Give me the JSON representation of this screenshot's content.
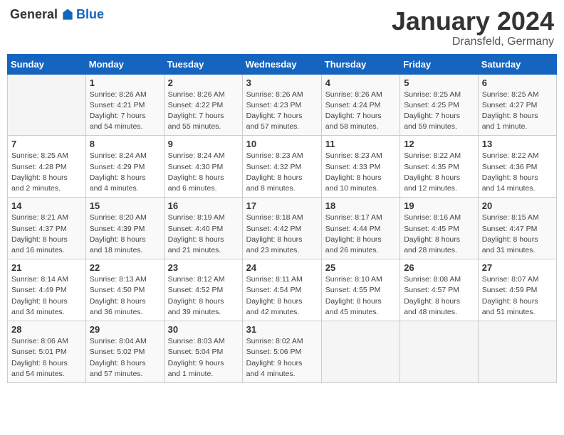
{
  "header": {
    "logo_general": "General",
    "logo_blue": "Blue",
    "month": "January 2024",
    "location": "Dransfeld, Germany"
  },
  "weekdays": [
    "Sunday",
    "Monday",
    "Tuesday",
    "Wednesday",
    "Thursday",
    "Friday",
    "Saturday"
  ],
  "weeks": [
    [
      {
        "day": "",
        "info": ""
      },
      {
        "day": "1",
        "info": "Sunrise: 8:26 AM\nSunset: 4:21 PM\nDaylight: 7 hours\nand 54 minutes."
      },
      {
        "day": "2",
        "info": "Sunrise: 8:26 AM\nSunset: 4:22 PM\nDaylight: 7 hours\nand 55 minutes."
      },
      {
        "day": "3",
        "info": "Sunrise: 8:26 AM\nSunset: 4:23 PM\nDaylight: 7 hours\nand 57 minutes."
      },
      {
        "day": "4",
        "info": "Sunrise: 8:26 AM\nSunset: 4:24 PM\nDaylight: 7 hours\nand 58 minutes."
      },
      {
        "day": "5",
        "info": "Sunrise: 8:25 AM\nSunset: 4:25 PM\nDaylight: 7 hours\nand 59 minutes."
      },
      {
        "day": "6",
        "info": "Sunrise: 8:25 AM\nSunset: 4:27 PM\nDaylight: 8 hours\nand 1 minute."
      }
    ],
    [
      {
        "day": "7",
        "info": "Sunrise: 8:25 AM\nSunset: 4:28 PM\nDaylight: 8 hours\nand 2 minutes."
      },
      {
        "day": "8",
        "info": "Sunrise: 8:24 AM\nSunset: 4:29 PM\nDaylight: 8 hours\nand 4 minutes."
      },
      {
        "day": "9",
        "info": "Sunrise: 8:24 AM\nSunset: 4:30 PM\nDaylight: 8 hours\nand 6 minutes."
      },
      {
        "day": "10",
        "info": "Sunrise: 8:23 AM\nSunset: 4:32 PM\nDaylight: 8 hours\nand 8 minutes."
      },
      {
        "day": "11",
        "info": "Sunrise: 8:23 AM\nSunset: 4:33 PM\nDaylight: 8 hours\nand 10 minutes."
      },
      {
        "day": "12",
        "info": "Sunrise: 8:22 AM\nSunset: 4:35 PM\nDaylight: 8 hours\nand 12 minutes."
      },
      {
        "day": "13",
        "info": "Sunrise: 8:22 AM\nSunset: 4:36 PM\nDaylight: 8 hours\nand 14 minutes."
      }
    ],
    [
      {
        "day": "14",
        "info": "Sunrise: 8:21 AM\nSunset: 4:37 PM\nDaylight: 8 hours\nand 16 minutes."
      },
      {
        "day": "15",
        "info": "Sunrise: 8:20 AM\nSunset: 4:39 PM\nDaylight: 8 hours\nand 18 minutes."
      },
      {
        "day": "16",
        "info": "Sunrise: 8:19 AM\nSunset: 4:40 PM\nDaylight: 8 hours\nand 21 minutes."
      },
      {
        "day": "17",
        "info": "Sunrise: 8:18 AM\nSunset: 4:42 PM\nDaylight: 8 hours\nand 23 minutes."
      },
      {
        "day": "18",
        "info": "Sunrise: 8:17 AM\nSunset: 4:44 PM\nDaylight: 8 hours\nand 26 minutes."
      },
      {
        "day": "19",
        "info": "Sunrise: 8:16 AM\nSunset: 4:45 PM\nDaylight: 8 hours\nand 28 minutes."
      },
      {
        "day": "20",
        "info": "Sunrise: 8:15 AM\nSunset: 4:47 PM\nDaylight: 8 hours\nand 31 minutes."
      }
    ],
    [
      {
        "day": "21",
        "info": "Sunrise: 8:14 AM\nSunset: 4:49 PM\nDaylight: 8 hours\nand 34 minutes."
      },
      {
        "day": "22",
        "info": "Sunrise: 8:13 AM\nSunset: 4:50 PM\nDaylight: 8 hours\nand 36 minutes."
      },
      {
        "day": "23",
        "info": "Sunrise: 8:12 AM\nSunset: 4:52 PM\nDaylight: 8 hours\nand 39 minutes."
      },
      {
        "day": "24",
        "info": "Sunrise: 8:11 AM\nSunset: 4:54 PM\nDaylight: 8 hours\nand 42 minutes."
      },
      {
        "day": "25",
        "info": "Sunrise: 8:10 AM\nSunset: 4:55 PM\nDaylight: 8 hours\nand 45 minutes."
      },
      {
        "day": "26",
        "info": "Sunrise: 8:08 AM\nSunset: 4:57 PM\nDaylight: 8 hours\nand 48 minutes."
      },
      {
        "day": "27",
        "info": "Sunrise: 8:07 AM\nSunset: 4:59 PM\nDaylight: 8 hours\nand 51 minutes."
      }
    ],
    [
      {
        "day": "28",
        "info": "Sunrise: 8:06 AM\nSunset: 5:01 PM\nDaylight: 8 hours\nand 54 minutes."
      },
      {
        "day": "29",
        "info": "Sunrise: 8:04 AM\nSunset: 5:02 PM\nDaylight: 8 hours\nand 57 minutes."
      },
      {
        "day": "30",
        "info": "Sunrise: 8:03 AM\nSunset: 5:04 PM\nDaylight: 9 hours\nand 1 minute."
      },
      {
        "day": "31",
        "info": "Sunrise: 8:02 AM\nSunset: 5:06 PM\nDaylight: 9 hours\nand 4 minutes."
      },
      {
        "day": "",
        "info": ""
      },
      {
        "day": "",
        "info": ""
      },
      {
        "day": "",
        "info": ""
      }
    ]
  ]
}
